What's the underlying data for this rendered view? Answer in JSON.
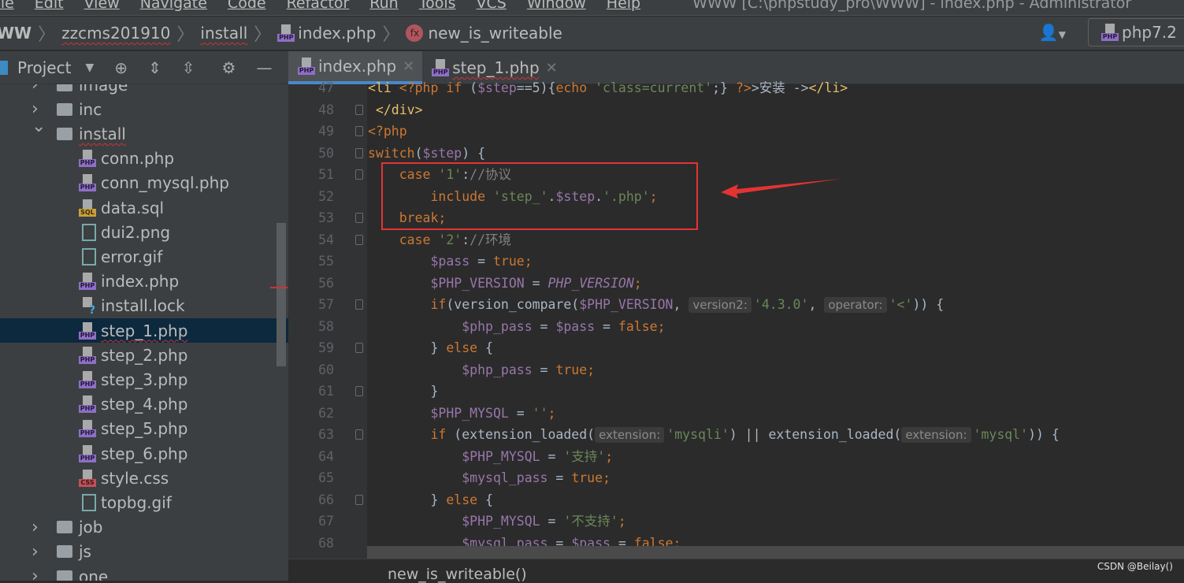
{
  "menu": {
    "items": [
      "File",
      "Edit",
      "View",
      "Navigate",
      "Code",
      "Refactor",
      "Run",
      "Tools",
      "VCS",
      "Window",
      "Help"
    ],
    "title": "WWW [C:\\phpstudy_pro\\WWW] - index.php - Administrator"
  },
  "breadcrumb": {
    "root": "WW",
    "project": "zzcms201910",
    "folder": "install",
    "file": "index.php",
    "function": "new_is_writeable"
  },
  "interpreter": "php7.2",
  "toolwindow": {
    "label": "Project"
  },
  "tabs": [
    {
      "label": "index.php",
      "active": true
    },
    {
      "label": "step_1.php",
      "active": false
    }
  ],
  "tree": [
    {
      "label": "image",
      "type": "folder",
      "depth": 1,
      "expanded": false
    },
    {
      "label": "inc",
      "type": "folder",
      "depth": 1,
      "expanded": false
    },
    {
      "label": "install",
      "type": "folder",
      "depth": 1,
      "expanded": true
    },
    {
      "label": "conn.php",
      "type": "php",
      "depth": 2
    },
    {
      "label": "conn_mysql.php",
      "type": "php",
      "depth": 2
    },
    {
      "label": "data.sql",
      "type": "sql",
      "depth": 2
    },
    {
      "label": "dui2.png",
      "type": "img",
      "depth": 2
    },
    {
      "label": "error.gif",
      "type": "img",
      "depth": 2
    },
    {
      "label": "index.php",
      "type": "php",
      "depth": 2
    },
    {
      "label": "install.lock",
      "type": "lock",
      "depth": 2
    },
    {
      "label": "step_1.php",
      "type": "php",
      "depth": 2,
      "selected": true
    },
    {
      "label": "step_2.php",
      "type": "php",
      "depth": 2
    },
    {
      "label": "step_3.php",
      "type": "php",
      "depth": 2
    },
    {
      "label": "step_4.php",
      "type": "php",
      "depth": 2
    },
    {
      "label": "step_5.php",
      "type": "php",
      "depth": 2
    },
    {
      "label": "step_6.php",
      "type": "php",
      "depth": 2
    },
    {
      "label": "style.css",
      "type": "css",
      "depth": 2
    },
    {
      "label": "topbg.gif",
      "type": "img",
      "depth": 2
    },
    {
      "label": "job",
      "type": "folder",
      "depth": 1,
      "expanded": false
    },
    {
      "label": "js",
      "type": "folder",
      "depth": 1,
      "expanded": false
    },
    {
      "label": "one",
      "type": "folder",
      "depth": 1,
      "expanded": false
    }
  ],
  "code": [
    {
      "n": 47,
      "t": [
        [
          "tag",
          "<li"
        ],
        [
          "",
          ""
        ],
        [
          "kw",
          " <?php if "
        ],
        [
          "",
          "("
        ],
        [
          "var",
          "$step"
        ],
        [
          "",
          "==5){"
        ],
        [
          "kw",
          "echo "
        ],
        [
          "str",
          "'class=current'"
        ],
        [
          "",
          ";} "
        ],
        [
          "kw",
          "?>"
        ],
        [
          "",
          ">安装 ->"
        ],
        [
          "tag",
          "</li>"
        ]
      ]
    },
    {
      "n": 48,
      "fold": true,
      "t": [
        [
          "tag",
          " </div>"
        ]
      ]
    },
    {
      "n": 49,
      "fold": true,
      "t": [
        [
          "kw",
          "<?php"
        ]
      ]
    },
    {
      "n": 50,
      "fold": true,
      "t": [
        [
          "kw",
          "switch"
        ],
        [
          "",
          "("
        ],
        [
          "var",
          "$step"
        ],
        [
          "",
          ") {"
        ]
      ]
    },
    {
      "n": 51,
      "fold": true,
      "t": [
        [
          "",
          "    "
        ],
        [
          "kw",
          "case "
        ],
        [
          "str",
          "'1'"
        ],
        [
          "",
          ":"
        ],
        [
          "cmt",
          "//协议"
        ]
      ]
    },
    {
      "n": 52,
      "t": [
        [
          "",
          "        "
        ],
        [
          "kw",
          "include "
        ],
        [
          "str",
          "'step_'"
        ],
        [
          "",
          "."
        ],
        [
          "var",
          "$step"
        ],
        [
          "",
          "."
        ],
        [
          "str",
          "'.php'"
        ],
        [
          "kw",
          ";"
        ]
      ]
    },
    {
      "n": 53,
      "fold": true,
      "t": [
        [
          "",
          "    "
        ],
        [
          "kw",
          "break;"
        ]
      ]
    },
    {
      "n": 54,
      "fold": true,
      "t": [
        [
          "",
          "    "
        ],
        [
          "kw",
          "case "
        ],
        [
          "str",
          "'2'"
        ],
        [
          "",
          ":"
        ],
        [
          "cmt",
          "//环境"
        ]
      ]
    },
    {
      "n": 55,
      "t": [
        [
          "",
          "        "
        ],
        [
          "var",
          "$pass"
        ],
        [
          "",
          " = "
        ],
        [
          "kw",
          "true;"
        ]
      ]
    },
    {
      "n": 56,
      "t": [
        [
          "",
          "        "
        ],
        [
          "var",
          "$PHP_VERSION"
        ],
        [
          "",
          " = "
        ],
        [
          "cst",
          "PHP_VERSION"
        ],
        [
          "kw",
          ";"
        ]
      ]
    },
    {
      "n": 57,
      "fold": true,
      "t": [
        [
          "",
          "        "
        ],
        [
          "kw",
          "if"
        ],
        [
          "",
          "(version_compare("
        ],
        [
          "var",
          "$PHP_VERSION"
        ],
        [
          "",
          ", "
        ],
        [
          "hint",
          "version2:"
        ],
        [
          "str",
          "'4.3.0'"
        ],
        [
          "",
          ", "
        ],
        [
          "hint",
          "operator:"
        ],
        [
          "str",
          "'<'"
        ],
        [
          "",
          ")) {"
        ]
      ]
    },
    {
      "n": 58,
      "t": [
        [
          "",
          "            "
        ],
        [
          "var",
          "$php_pass"
        ],
        [
          "",
          " = "
        ],
        [
          "var",
          "$pass"
        ],
        [
          "",
          " = "
        ],
        [
          "kw",
          "false;"
        ]
      ]
    },
    {
      "n": 59,
      "fold": true,
      "t": [
        [
          "",
          "        } "
        ],
        [
          "kw",
          "else "
        ],
        [
          "",
          "{"
        ]
      ]
    },
    {
      "n": 60,
      "t": [
        [
          "",
          "            "
        ],
        [
          "var",
          "$php_pass"
        ],
        [
          "",
          " = "
        ],
        [
          "kw",
          "true;"
        ]
      ]
    },
    {
      "n": 61,
      "fold": true,
      "t": [
        [
          "",
          "        }"
        ]
      ]
    },
    {
      "n": 62,
      "t": [
        [
          "",
          "        "
        ],
        [
          "var",
          "$PHP_MYSQL"
        ],
        [
          "",
          " = "
        ],
        [
          "str",
          "''"
        ],
        [
          "kw",
          ";"
        ]
      ]
    },
    {
      "n": 63,
      "fold": true,
      "t": [
        [
          "",
          "        "
        ],
        [
          "kw",
          "if "
        ],
        [
          "",
          "(extension_loaded("
        ],
        [
          "hint",
          "extension:"
        ],
        [
          "str",
          "'mysqli'"
        ],
        [
          "",
          ") || extension_loaded("
        ],
        [
          "hint",
          "extension:"
        ],
        [
          "str",
          "'mysql'"
        ],
        [
          "",
          ")) {"
        ]
      ]
    },
    {
      "n": 64,
      "t": [
        [
          "",
          "            "
        ],
        [
          "var",
          "$PHP_MYSQL"
        ],
        [
          "",
          " = "
        ],
        [
          "str",
          "'支持'"
        ],
        [
          "kw",
          ";"
        ]
      ]
    },
    {
      "n": 65,
      "t": [
        [
          "",
          "            "
        ],
        [
          "var",
          "$mysql_pass"
        ],
        [
          "",
          " = "
        ],
        [
          "kw",
          "true;"
        ]
      ]
    },
    {
      "n": 66,
      "fold": true,
      "t": [
        [
          "",
          "        } "
        ],
        [
          "kw",
          "else "
        ],
        [
          "",
          "{"
        ]
      ]
    },
    {
      "n": 67,
      "t": [
        [
          "",
          "            "
        ],
        [
          "var",
          "$PHP_MYSQL"
        ],
        [
          "",
          " = "
        ],
        [
          "str",
          "'不支持'"
        ],
        [
          "kw",
          ";"
        ]
      ]
    },
    {
      "n": 68,
      "t": [
        [
          "",
          "            "
        ],
        [
          "var",
          "$mysql_pass"
        ],
        [
          "",
          " = "
        ],
        [
          "var",
          "$pass"
        ],
        [
          "",
          " = "
        ],
        [
          "kw",
          "false;"
        ]
      ]
    }
  ],
  "status": {
    "function_hint": "new_is_writeable()"
  },
  "watermark": "CSDN @Beilay()",
  "colors": {
    "annotation": "#e53333",
    "keyword": "#cc7832",
    "string": "#6a8759",
    "variable": "#9876aa"
  }
}
